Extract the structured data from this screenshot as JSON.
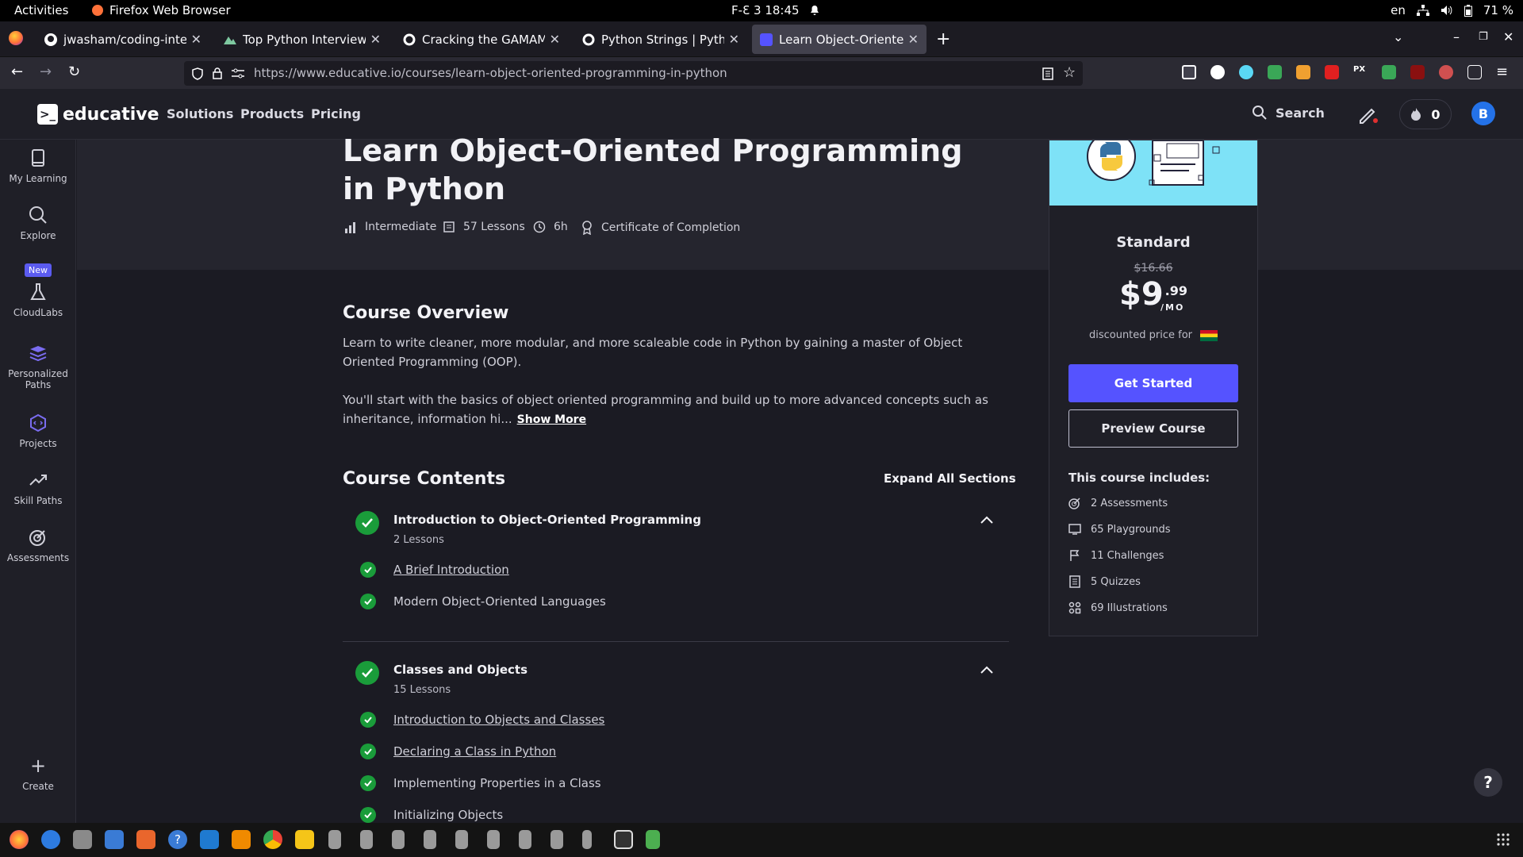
{
  "system": {
    "activities": "Activities",
    "app_name": "Firefox Web Browser",
    "clock": "F-Ɛ 3  18:45",
    "lang": "en",
    "battery": "71 %"
  },
  "browser": {
    "tabs": [
      {
        "title": "jwasham/coding-intervie",
        "color": "#ffffff"
      },
      {
        "title": "Top Python Interview Qu",
        "color": "#7ec8a0"
      },
      {
        "title": "Cracking the GAMAM Tec",
        "color": "#ffffff"
      },
      {
        "title": "Python Strings | Python",
        "color": "#ffffff"
      },
      {
        "title": "Learn Object-Oriented Pr",
        "color": "#5553ff"
      }
    ],
    "url": "https://www.educative.io/courses/learn-object-oriented-programming-in-python"
  },
  "header": {
    "logo_text": "educative",
    "nav": [
      "Solutions",
      "Products",
      "Pricing"
    ],
    "search_label": "Search",
    "streak_count": "0",
    "avatar_letter": "B"
  },
  "sidebar": {
    "items": [
      {
        "label": "My Learning",
        "icon": "book-icon"
      },
      {
        "label": "Explore",
        "icon": "search-icon"
      },
      {
        "label": "CloudLabs",
        "icon": "flask-icon",
        "badge": "New"
      },
      {
        "label": "Personalized Paths",
        "icon": "layers-icon"
      },
      {
        "label": "Projects",
        "icon": "puzzle-icon"
      },
      {
        "label": "Skill Paths",
        "icon": "trend-icon"
      },
      {
        "label": "Assessments",
        "icon": "target-icon"
      }
    ],
    "create_label": "Create"
  },
  "course": {
    "title": "Learn Object-Oriented Programming in Python",
    "level": "Intermediate",
    "lessons": "57 Lessons",
    "duration": "6h",
    "certificate": "Certificate of Completion"
  },
  "pricing": {
    "plan": "Standard",
    "old_price": "$16.66",
    "price_dollars": "$9",
    "price_cents": ".99",
    "per": "/MO",
    "discount_note": "discounted price for",
    "get_started": "Get Started",
    "preview": "Preview Course",
    "includes_title": "This course includes:",
    "includes": [
      {
        "label": "2 Assessments",
        "icon": "target-icon"
      },
      {
        "label": "65 Playgrounds",
        "icon": "playground-icon"
      },
      {
        "label": "11 Challenges",
        "icon": "flag-icon"
      },
      {
        "label": "5 Quizzes",
        "icon": "quiz-icon"
      },
      {
        "label": "69 Illustrations",
        "icon": "illustration-icon"
      }
    ]
  },
  "overview": {
    "heading": "Course Overview",
    "p1": "Learn to write cleaner, more modular, and more scaleable code in Python by gaining a master of Object Oriented Programming (OOP).",
    "p2": "You'll start with the basics of object oriented programming and build up to more advanced concepts such as inheritance, information hi...",
    "show_more": "Show More"
  },
  "contents": {
    "heading": "Course Contents",
    "expand_all": "Expand All Sections",
    "sections": [
      {
        "title": "Introduction to Object-Oriented Programming",
        "count": "2 Lessons",
        "lessons": [
          "A Brief Introduction",
          "Modern Object-Oriented Languages"
        ]
      },
      {
        "title": "Classes and Objects",
        "count": "15 Lessons",
        "lessons": [
          "Introduction to Objects and Classes",
          "Declaring a Class in Python",
          "Implementing Properties in a Class",
          "Initializing Objects"
        ]
      }
    ]
  },
  "help_label": "?"
}
